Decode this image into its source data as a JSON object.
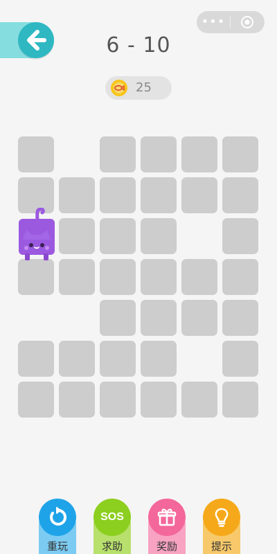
{
  "status": {
    "left": "",
    "right": ""
  },
  "header": {
    "level": "6 - 10",
    "coins": "25"
  },
  "capsule": {
    "more": "•••"
  },
  "board": {
    "rows": 7,
    "cols": 6,
    "cells": [
      [
        1,
        0,
        1,
        1,
        1,
        1
      ],
      [
        1,
        1,
        1,
        1,
        1,
        1
      ],
      [
        0,
        1,
        1,
        1,
        0,
        1
      ],
      [
        1,
        1,
        1,
        1,
        1,
        1
      ],
      [
        0,
        0,
        1,
        1,
        1,
        1
      ],
      [
        1,
        1,
        1,
        1,
        0,
        1
      ],
      [
        1,
        1,
        1,
        1,
        1,
        1
      ]
    ],
    "player": {
      "row": 2,
      "col": 0
    }
  },
  "actions": [
    {
      "label": "重玩",
      "icon": "replay-icon",
      "color": "#1fa3e8",
      "base": "#7ccbf2"
    },
    {
      "label": "求助",
      "icon": "sos-icon",
      "color": "#8ccf1f",
      "base": "#b8e06c",
      "text": "SOS"
    },
    {
      "label": "奖励",
      "icon": "gift-icon",
      "color": "#f4679a",
      "base": "#f7a3c1"
    },
    {
      "label": "提示",
      "icon": "lightbulb-icon",
      "color": "#f5a91a",
      "base": "#f7c96a"
    }
  ],
  "colors": {
    "background": "#f5f5f5",
    "tile": "#cdcdcd",
    "cat": "#9b59e0",
    "back": "#2fb8c2"
  }
}
